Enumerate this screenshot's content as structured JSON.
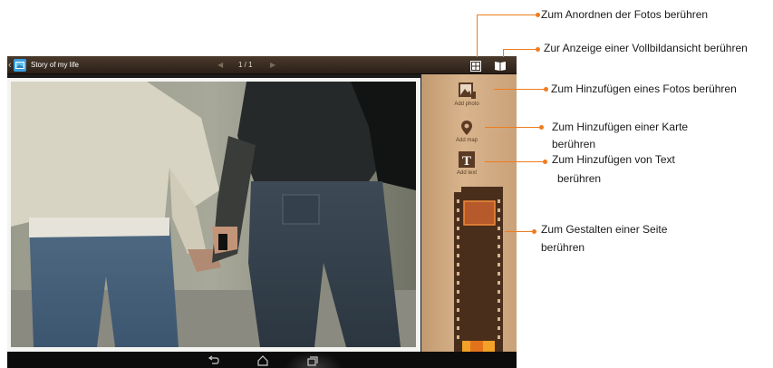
{
  "app": {
    "title": "Story of my life",
    "page_indicator": "1 / 1",
    "prev_glyph": "◀",
    "next_glyph": "▶",
    "back_glyph": "‹",
    "icons": {
      "app": "story-album-icon",
      "arrange": "arrange-grid-icon",
      "fullscreen": "open-book-icon"
    }
  },
  "tools": {
    "add_photo": "Add photo",
    "add_map": "Add map",
    "add_text": "Add text",
    "text_glyph": "T"
  },
  "navbar": {
    "icons": [
      "back-icon",
      "home-icon",
      "recent-apps-icon"
    ]
  },
  "callouts": {
    "arrange": "Zum Anordnen der Fotos berühren",
    "fullscreen": "Zur Anzeige einer Vollbildansicht berühren",
    "add_photo": "Zum Hinzufügen eines Fotos berühren",
    "add_map_line1": "Zum Hinzufügen einer Karte",
    "add_map_line2": "berühren",
    "add_text_line1": "Zum Hinzufügen von Text",
    "add_text_line2": "berühren",
    "page_design_line1": "Zum Gestalten einer Seite",
    "page_design_line2": "berühren"
  },
  "colors": {
    "accent": "#ef7c1f",
    "topbar": "#3a2c21",
    "panel": "#d2ad85"
  }
}
